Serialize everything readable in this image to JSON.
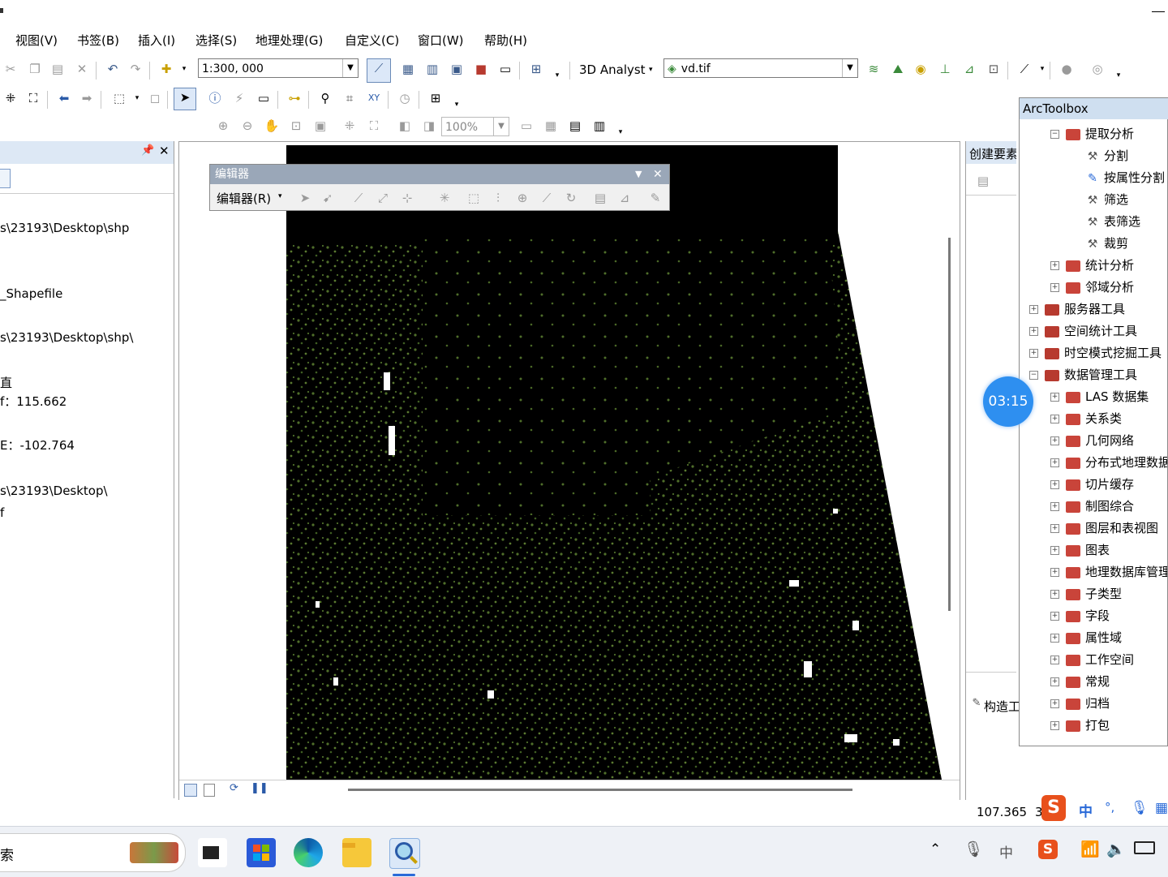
{
  "menu": [
    "视图(V)",
    "书签(B)",
    "插入(I)",
    "选择(S)",
    "地理处理(G)",
    "自定义(C)",
    "窗口(W)",
    "帮助(H)"
  ],
  "toolbar": {
    "scale_value": "1:300, 000",
    "extension_label": "3D Analyst",
    "layer_combo": "vd.tif",
    "zoom_percent": "100%"
  },
  "toc": {
    "lines": [
      "s\\23193\\Desktop\\shp",
      "_Shapefile",
      "s\\23193\\Desktop\\shp\\",
      "直",
      "f：115.662",
      "E：-102.764",
      "s\\23193\\Desktop\\",
      "f"
    ]
  },
  "editor": {
    "title": "编辑器",
    "menu_label": "编辑器(R)"
  },
  "create_features": {
    "title": "创建要素",
    "bottom_tab": "构造工"
  },
  "arctoolbox": {
    "title": "ArcToolbox",
    "items": [
      {
        "label": "提取分析",
        "level": 1,
        "expander": "⊟",
        "icon": "toolbox"
      },
      {
        "label": "分割",
        "level": 2,
        "expander": "",
        "icon": "tool"
      },
      {
        "label": "按属性分割",
        "level": 2,
        "expander": "",
        "icon": "script"
      },
      {
        "label": "筛选",
        "level": 2,
        "expander": "",
        "icon": "tool"
      },
      {
        "label": "表筛选",
        "level": 2,
        "expander": "",
        "icon": "tool"
      },
      {
        "label": "裁剪",
        "level": 2,
        "expander": "",
        "icon": "tool"
      },
      {
        "label": "统计分析",
        "level": 1,
        "expander": "⊞",
        "icon": "toolbox"
      },
      {
        "label": "邻域分析",
        "level": 1,
        "expander": "⊞",
        "icon": "toolbox"
      },
      {
        "label": "服务器工具",
        "level": 0,
        "expander": "⊞",
        "icon": "toolbox"
      },
      {
        "label": "空间统计工具",
        "level": 0,
        "expander": "⊞",
        "icon": "toolbox"
      },
      {
        "label": "时空模式挖掘工具",
        "level": 0,
        "expander": "⊞",
        "icon": "toolbox"
      },
      {
        "label": "数据管理工具",
        "level": 0,
        "expander": "⊟",
        "icon": "toolbox"
      },
      {
        "label": "LAS 数据集",
        "level": 1,
        "expander": "⊞",
        "icon": "toolbox"
      },
      {
        "label": "关系类",
        "level": 1,
        "expander": "⊞",
        "icon": "toolbox"
      },
      {
        "label": "几何网络",
        "level": 1,
        "expander": "⊞",
        "icon": "toolbox"
      },
      {
        "label": "分布式地理数据",
        "level": 1,
        "expander": "⊞",
        "icon": "toolbox"
      },
      {
        "label": "切片缓存",
        "level": 1,
        "expander": "⊞",
        "icon": "toolbox"
      },
      {
        "label": "制图综合",
        "level": 1,
        "expander": "⊞",
        "icon": "toolbox"
      },
      {
        "label": "图层和表视图",
        "level": 1,
        "expander": "⊞",
        "icon": "toolbox"
      },
      {
        "label": "图表",
        "level": 1,
        "expander": "⊞",
        "icon": "toolbox"
      },
      {
        "label": "地理数据库管理",
        "level": 1,
        "expander": "⊞",
        "icon": "toolbox"
      },
      {
        "label": "子类型",
        "level": 1,
        "expander": "⊞",
        "icon": "toolbox"
      },
      {
        "label": "字段",
        "level": 1,
        "expander": "⊞",
        "icon": "toolbox"
      },
      {
        "label": "属性域",
        "level": 1,
        "expander": "⊞",
        "icon": "toolbox"
      },
      {
        "label": "工作空间",
        "level": 1,
        "expander": "⊞",
        "icon": "toolbox"
      },
      {
        "label": "常规",
        "level": 1,
        "expander": "⊞",
        "icon": "toolbox"
      },
      {
        "label": "归档",
        "level": 1,
        "expander": "⊞",
        "icon": "toolbox"
      },
      {
        "label": "打包",
        "level": 1,
        "expander": "⊞",
        "icon": "toolbox"
      }
    ]
  },
  "timer": "03:15",
  "status": {
    "coord": "107.365",
    "coord_tail": "3"
  },
  "ime": {
    "lang": "中",
    "punct": "°,"
  },
  "taskbar": {
    "search_text": "索",
    "ime_lang": "中"
  },
  "colors": {
    "accent": "#2e8ff0",
    "raster_black": "#000000",
    "vegetation_green": "#4f6e2a",
    "toolbox_red": "#b73a2f"
  }
}
